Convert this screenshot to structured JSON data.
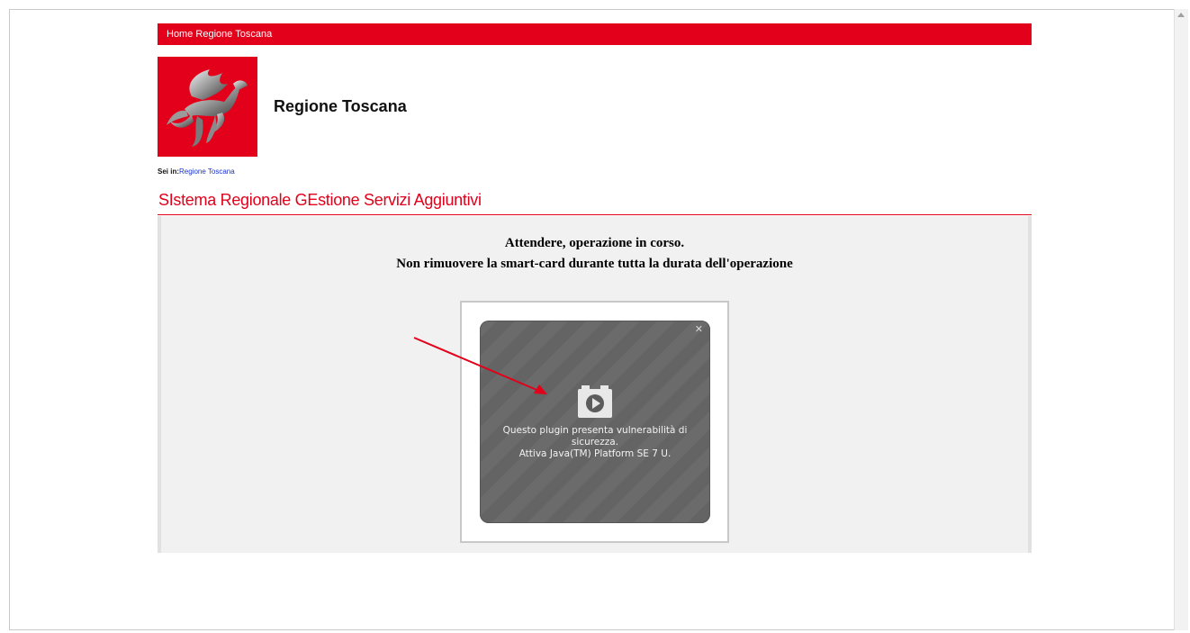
{
  "top_bar": {
    "home_link": "Home Regione Toscana"
  },
  "header": {
    "site_title": "Regione Toscana"
  },
  "breadcrumb": {
    "label": "Sei in:",
    "link": "Regione Toscana"
  },
  "section": {
    "title": "SIstema Regionale GEstione Servizi Aggiuntivi"
  },
  "content": {
    "line1": "Attendere, operazione in corso.",
    "line2": "Non rimuovere la smart-card durante tutta la durata dell'operazione"
  },
  "plugin": {
    "close_glyph": "✕",
    "message_1": "Questo plugin presenta vulnerabilità di sicurezza.",
    "message_2": "Attiva Java(TM) Platform SE 7 U."
  },
  "icons": {
    "logo": "pegasus-logo",
    "plugin": "plugin-play-icon",
    "annotation": "red-arrow"
  },
  "colors": {
    "brand_red": "#e2001a",
    "link_blue": "#1a32c8",
    "content_bg": "#f1f1f1",
    "plugin_bg": "#6b6b6b"
  }
}
